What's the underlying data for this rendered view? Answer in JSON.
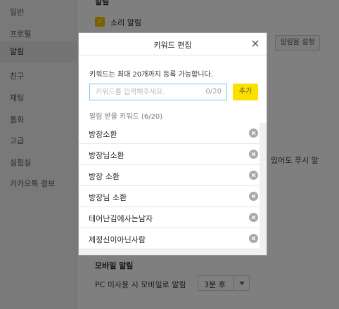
{
  "sidebar": {
    "items": [
      {
        "label": "일반"
      },
      {
        "label": "프로필"
      },
      {
        "label": "알림"
      },
      {
        "label": "친구"
      },
      {
        "label": "채팅"
      },
      {
        "label": "통화"
      },
      {
        "label": "고급"
      },
      {
        "label": "실험실"
      },
      {
        "label": "카카오톡 정보"
      }
    ],
    "active_index": 2
  },
  "settings": {
    "section_notify": "알림",
    "sound_alarm": "소리 알림",
    "notify_settings_button": "알림음 설정",
    "partial_text": "있어도 푸시 알",
    "mobile_section": "모바일 알림",
    "mobile_label": "PC 미사용 시 모바일로 알림",
    "mobile_select_value": "3분 후"
  },
  "modal": {
    "title": "키워드 편집",
    "description": "키워드는 최대 20개까지 등록 가능합니다.",
    "input_placeholder": "키워드를 입력해주세요.",
    "input_value": "",
    "char_count": "0/20",
    "add_button": "추가",
    "list_header": "알림 받을 키워드 (6/20)",
    "keywords": [
      {
        "text": "방장소환"
      },
      {
        "text": "방장님소환"
      },
      {
        "text": "방장 소환"
      },
      {
        "text": "방장님 소환"
      },
      {
        "text": "태어난김에사는남자"
      },
      {
        "text": "제정신이아닌사람"
      }
    ]
  },
  "colors": {
    "accent_yellow": "#fae100",
    "check_yellow": "#f5c400",
    "input_border": "#7ec0ec",
    "overlay": "rgba(0,0,0,0.5)"
  }
}
